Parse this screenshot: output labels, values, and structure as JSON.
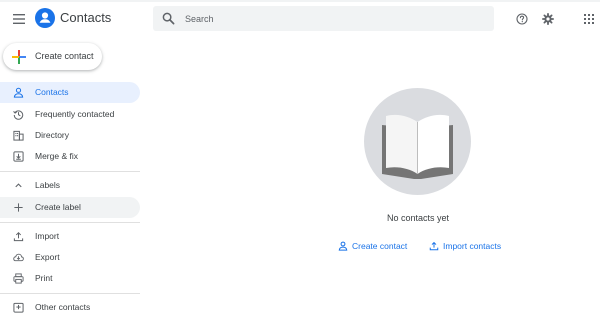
{
  "app": {
    "title": "Contacts"
  },
  "search": {
    "placeholder": "Search",
    "value": ""
  },
  "sidebar": {
    "create_contact_label": "Create contact",
    "items": [
      {
        "label": "Contacts",
        "icon": "person-icon",
        "active": true
      },
      {
        "label": "Frequently contacted",
        "icon": "history-icon"
      },
      {
        "label": "Directory",
        "icon": "directory-icon"
      },
      {
        "label": "Merge & fix",
        "icon": "merge-icon"
      }
    ],
    "labels_section": {
      "label": "Labels",
      "create_label": "Create label"
    },
    "tools": [
      {
        "label": "Import",
        "icon": "upload-icon"
      },
      {
        "label": "Export",
        "icon": "cloud-download-icon"
      },
      {
        "label": "Print",
        "icon": "print-icon"
      }
    ],
    "other": {
      "label": "Other contacts",
      "icon": "other-contacts-icon"
    }
  },
  "main": {
    "empty_text": "No contacts yet",
    "create_contact_link": "Create contact",
    "import_contacts_link": "Import contacts"
  },
  "colors": {
    "accent": "#1a73e8",
    "active_bg": "#e8f0fe",
    "search_bg": "#f1f3f4",
    "illustration_bg": "#dadce0"
  }
}
